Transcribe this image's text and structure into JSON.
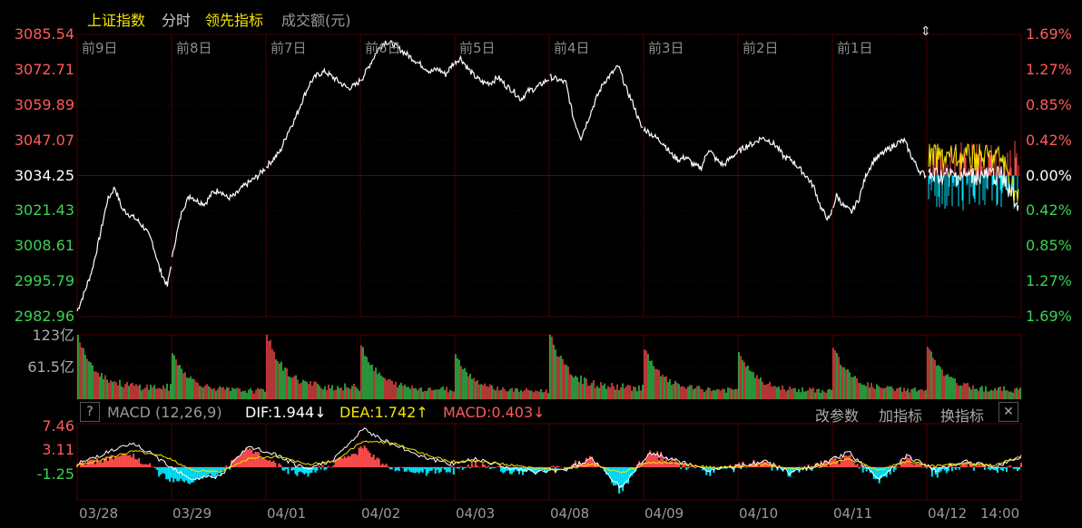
{
  "header": {
    "tabs": [
      {
        "label": "上证指数",
        "color": "#f5e600"
      },
      {
        "label": "分时",
        "color": "#cccccc"
      },
      {
        "label": "领先指标",
        "color": "#f5e600"
      },
      {
        "label": "成交额(元)",
        "color": "#999999"
      }
    ]
  },
  "price_axis": {
    "left_ticks": [
      "3085.54",
      "3072.71",
      "3059.89",
      "3047.07",
      "3034.25",
      "3021.43",
      "3008.61",
      "2995.79",
      "2982.96"
    ],
    "right_ticks": [
      "1.69%",
      "1.27%",
      "0.85%",
      "0.42%",
      "0.00%",
      "0.42%",
      "0.85%",
      "1.27%",
      "1.69%"
    ]
  },
  "day_labels": [
    "前9日",
    "前8日",
    "前7日",
    "前6日",
    "前5日",
    "前4日",
    "前3日",
    "前2日",
    "前1日"
  ],
  "volume_axis": {
    "ticks": [
      "123亿",
      "61.5亿"
    ]
  },
  "macd_header": {
    "help": "?",
    "name": "MACD (12,26,9)",
    "dif": "DIF:1.944↓",
    "dea": "DEA:1.742↑",
    "macd": "MACD:0.403↓",
    "btn_params": "改参数",
    "btn_add": "加指标",
    "btn_switch": "换指标",
    "close": "✕"
  },
  "macd_axis": {
    "ticks": [
      "7.46",
      "3.11",
      "-1.25"
    ]
  },
  "date_labels": [
    "03/28",
    "03/29",
    "04/01",
    "04/02",
    "04/03",
    "04/08",
    "04/09",
    "04/10",
    "04/11",
    "04/12",
    "14:00"
  ],
  "colors": {
    "up": "#ff4d4d",
    "down": "#39d353",
    "macd_down": "#00e5ff",
    "dif": "#ffffff",
    "dea": "#f5e600",
    "grid": "#3a0000"
  },
  "chart_data": [
    {
      "type": "line",
      "title": "上证指数",
      "ylim": [
        2982.96,
        3085.54
      ],
      "base": 3034.25,
      "x": [
        "03/28",
        "03/29",
        "04/01",
        "04/02",
        "04/03",
        "04/08",
        "04/09",
        "04/10",
        "04/11",
        "04/12"
      ],
      "series": [
        {
          "name": "上证指数",
          "values": [
            2985,
            2992,
            3000,
            3012,
            3025,
            3030,
            3022,
            3020,
            3018,
            3015,
            3010,
            3000,
            2994,
            3010,
            3022,
            3027,
            3025,
            3024,
            3028,
            3029,
            3026,
            3027,
            3030,
            3032,
            3034,
            3037,
            3040,
            3043,
            3050,
            3055,
            3062,
            3068,
            3071,
            3072,
            3070,
            3068,
            3066,
            3067,
            3070,
            3075,
            3080,
            3083,
            3082,
            3080,
            3078,
            3076,
            3074,
            3072,
            3073,
            3071,
            3075,
            3077,
            3073,
            3070,
            3068,
            3068,
            3070,
            3067,
            3065,
            3062,
            3065,
            3066,
            3068,
            3070,
            3069,
            3068,
            3055,
            3048,
            3055,
            3062,
            3068,
            3071,
            3074,
            3066,
            3060,
            3052,
            3050,
            3048,
            3046,
            3042,
            3040,
            3041,
            3038,
            3037,
            3044,
            3040,
            3038,
            3041,
            3043,
            3045,
            3046,
            3048,
            3047,
            3045,
            3041,
            3040,
            3037,
            3034,
            3030,
            3022,
            3018,
            3027,
            3023,
            3021,
            3026,
            3035,
            3040,
            3042,
            3044,
            3046,
            3047,
            3041,
            3036,
            3034
          ]
        }
      ]
    },
    {
      "type": "bar",
      "title": "成交额(元)",
      "ylim": [
        0,
        123
      ],
      "x": [
        "03/28",
        "03/29",
        "04/01",
        "04/02",
        "04/03",
        "04/08",
        "04/09",
        "04/10",
        "04/11",
        "04/12"
      ],
      "series": [
        {
          "name": "成交额",
          "values": [
            123,
            88,
            123,
            103,
            86,
            123,
            95,
            90,
            98,
            100
          ]
        }
      ]
    },
    {
      "type": "line",
      "title": "MACD (12,26,9)",
      "ylim": [
        -5.6,
        7.46
      ],
      "x": [
        "03/28",
        "03/29",
        "04/01",
        "04/02",
        "04/03",
        "04/08",
        "04/09",
        "04/10",
        "04/11",
        "04/12"
      ],
      "series": [
        {
          "name": "DIF",
          "values": [
            0.5,
            2.5,
            4.0,
            1.0,
            -2.0,
            -1.5,
            3.5,
            2.0,
            -0.5,
            1.5,
            6.5,
            4.0,
            2.0,
            0.5,
            1.5,
            0.0,
            -0.8,
            -0.5,
            1.5,
            -3.5,
            2.5,
            1.0,
            -0.5,
            0.0,
            1.0,
            -1.0,
            0.5,
            2.5,
            -2.0,
            2.0,
            -0.5,
            1.0,
            0.0,
            1.944
          ]
        },
        {
          "name": "DEA",
          "values": [
            0.3,
            1.5,
            2.8,
            2.0,
            -0.5,
            -0.8,
            1.5,
            1.8,
            0.5,
            1.0,
            4.5,
            4.2,
            2.5,
            1.0,
            1.0,
            0.5,
            -0.3,
            -0.3,
            0.5,
            -1.0,
            0.8,
            0.8,
            0.0,
            0.0,
            0.5,
            -0.3,
            0.2,
            1.5,
            -0.5,
            1.0,
            0.2,
            0.6,
            0.3,
            1.742
          ]
        }
      ]
    }
  ]
}
